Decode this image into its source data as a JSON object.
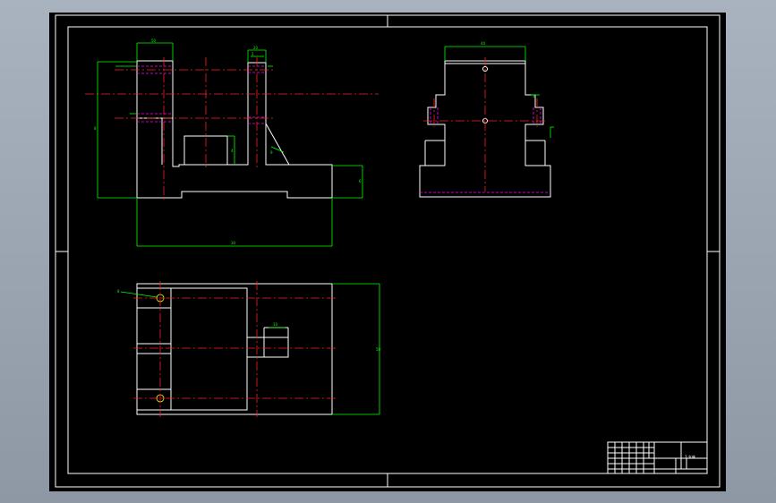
{
  "front_view": {
    "dim_top_left": "50",
    "dim_top_right": "20",
    "dim_small_a": "2",
    "dim_left_height": "8",
    "dim_slot_height": "4",
    "dim_rib": "9",
    "dim_base_height": "6",
    "dim_bottom_width": "30"
  },
  "side_view": {
    "dim_top_width": "44",
    "dim_right_small": "3"
  },
  "top_view": {
    "dim_hole": "8",
    "dim_block_width": "10",
    "dim_total_height": "50"
  },
  "title_block": {
    "part_label": "3 支座"
  },
  "colors": {
    "outline": "#ffffff",
    "dimension": "#00ff00",
    "centerline": "#ff2020",
    "hidden": "#ff00ff",
    "hole_mark": "#ffff00"
  }
}
